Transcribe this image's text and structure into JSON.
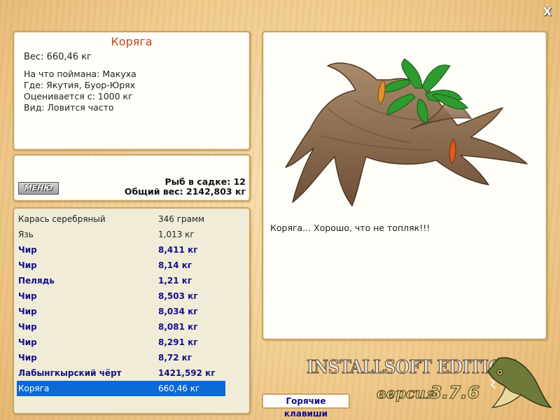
{
  "window": {
    "close_label": "X"
  },
  "info": {
    "title": "Коряга",
    "weight": "Вес: 660,46 кг",
    "lines": [
      "На что поймана: Макуха",
      "Где: Якутия, Буор-Юрях",
      "Оценивается с: 1000 кг",
      "Вид: Ловится часто"
    ]
  },
  "menu": {
    "button_label": "МЕНЮ",
    "fish_count": "Рыб в садке: 12",
    "total_weight": "Общий вес: 2142,803 кг"
  },
  "catch_list": [
    {
      "name": "Карась серебряный",
      "weight": "346 грамм",
      "bold": false,
      "selected": false
    },
    {
      "name": "Язь",
      "weight": "1,013 кг",
      "bold": false,
      "selected": false
    },
    {
      "name": "Чир",
      "weight": "8,411 кг",
      "bold": true,
      "selected": false
    },
    {
      "name": "Чир",
      "weight": "8,14 кг",
      "bold": true,
      "selected": false
    },
    {
      "name": "Пелядь",
      "weight": "1,21 кг",
      "bold": true,
      "selected": false
    },
    {
      "name": "Чир",
      "weight": "8,503 кг",
      "bold": true,
      "selected": false
    },
    {
      "name": "Чир",
      "weight": "8,034 кг",
      "bold": true,
      "selected": false
    },
    {
      "name": "Чир",
      "weight": "8,081 кг",
      "bold": true,
      "selected": false
    },
    {
      "name": "Чир",
      "weight": "8,291 кг",
      "bold": true,
      "selected": false
    },
    {
      "name": "Чир",
      "weight": "8,72 кг",
      "bold": true,
      "selected": false
    },
    {
      "name": "Лабынгкырский чёрт",
      "weight": "1421,592 кг",
      "bold": true,
      "selected": false
    },
    {
      "name": "Коряга",
      "weight": "660,46 кг",
      "bold": false,
      "selected": true
    }
  ],
  "picture": {
    "icon": "driftwood-snag-icon",
    "caption": "Коряга... Хорошо, что не топляк!!!"
  },
  "hotkeys_label": "Горячие клавиши",
  "branding": {
    "edition": "INSTALLSOFT EDITION",
    "version_label": "версия",
    "version_number": "3.7.6",
    "logo_icon": "pike-fish-icon"
  },
  "colors": {
    "title": "#c0461a",
    "bold_entry": "#12128c",
    "selection": "#0c6ad6",
    "panel_border": "#c9a46a"
  }
}
